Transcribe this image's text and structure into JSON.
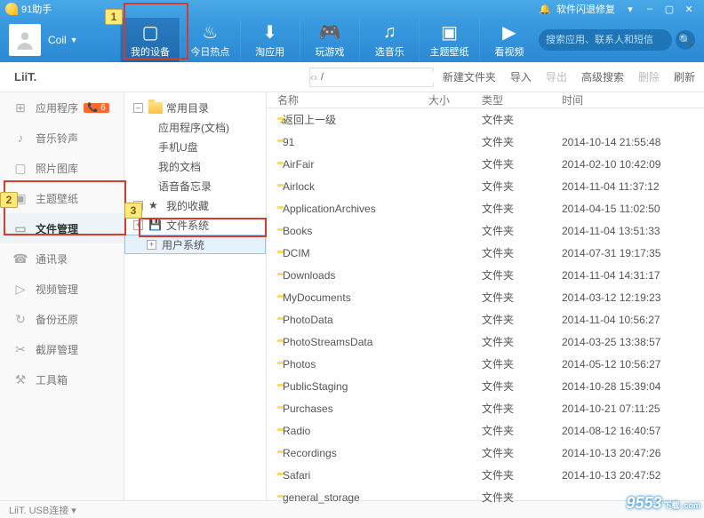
{
  "titlebar": {
    "app_name": "91助手",
    "flash_repair": "软件闪退修复"
  },
  "user": {
    "name": "Coil"
  },
  "nav": {
    "items": [
      {
        "label": "我的设备",
        "icon": "▢"
      },
      {
        "label": "今日热点",
        "icon": "♨"
      },
      {
        "label": "淘应用",
        "icon": "⬇"
      },
      {
        "label": "玩游戏",
        "icon": "🎮"
      },
      {
        "label": "选音乐",
        "icon": "♫"
      },
      {
        "label": "主题壁纸",
        "icon": "▣"
      },
      {
        "label": "看视频",
        "icon": "▶"
      }
    ]
  },
  "search": {
    "placeholder": "搜索应用、联系人和短信"
  },
  "device": {
    "name": "LiiT."
  },
  "actions": {
    "new_folder": "新建文件夹",
    "import": "导入",
    "export": "导出",
    "advanced_search": "高级搜索",
    "delete": "删除",
    "refresh": "刷新"
  },
  "sidebar": {
    "items": [
      {
        "label": "应用程序",
        "icon": "⊞",
        "badge": "📞 6"
      },
      {
        "label": "音乐铃声",
        "icon": "♪"
      },
      {
        "label": "照片图库",
        "icon": "▢"
      },
      {
        "label": "主题壁纸",
        "icon": "▣"
      },
      {
        "label": "文件管理",
        "icon": "▭"
      },
      {
        "label": "通讯录",
        "icon": "☎"
      },
      {
        "label": "视频管理",
        "icon": "▷"
      },
      {
        "label": "备份还原",
        "icon": "↻"
      },
      {
        "label": "截屏管理",
        "icon": "✂"
      },
      {
        "label": "工具箱",
        "icon": "⚒"
      }
    ]
  },
  "tree": {
    "root": "常用目录",
    "children1": [
      "应用程序(文档)",
      "手机U盘",
      "我的文档",
      "语音备忘录"
    ],
    "fav": "我的收藏",
    "fs": "文件系统",
    "usr": "用户系统"
  },
  "columns": {
    "name": "名称",
    "size": "大小",
    "type": "类型",
    "time": "时间"
  },
  "type_folder": "文件夹",
  "rows": [
    {
      "name": "返回上一级",
      "up": true,
      "time": ""
    },
    {
      "name": "91",
      "time": "2014-10-14 21:55:48"
    },
    {
      "name": "AirFair",
      "time": "2014-02-10 10:42:09"
    },
    {
      "name": "Airlock",
      "time": "2014-11-04 11:37:12"
    },
    {
      "name": "ApplicationArchives",
      "time": "2014-04-15 11:02:50"
    },
    {
      "name": "Books",
      "time": "2014-11-04 13:51:33"
    },
    {
      "name": "DCIM",
      "time": "2014-07-31 19:17:35"
    },
    {
      "name": "Downloads",
      "time": "2014-11-04 14:31:17"
    },
    {
      "name": "MyDocuments",
      "time": "2014-03-12 12:19:23"
    },
    {
      "name": "PhotoData",
      "time": "2014-11-04 10:56:27"
    },
    {
      "name": "PhotoStreamsData",
      "time": "2014-03-25 13:38:57"
    },
    {
      "name": "Photos",
      "time": "2014-05-12 10:56:27"
    },
    {
      "name": "PublicStaging",
      "time": "2014-10-28 15:39:04"
    },
    {
      "name": "Purchases",
      "time": "2014-10-21 07:11:25"
    },
    {
      "name": "Radio",
      "time": "2014-08-12 16:40:57"
    },
    {
      "name": "Recordings",
      "time": "2014-10-13 20:47:26"
    },
    {
      "name": "Safari",
      "time": "2014-10-13 20:47:52"
    },
    {
      "name": "general_storage",
      "time": ""
    }
  ],
  "status": "LiiT.  USB连接 ▾",
  "watermark": {
    "main": "9553",
    "sub": "下载\n.com"
  },
  "annotations": {
    "n1": "1",
    "n2": "2",
    "n3": "3"
  },
  "addr_value": "/"
}
